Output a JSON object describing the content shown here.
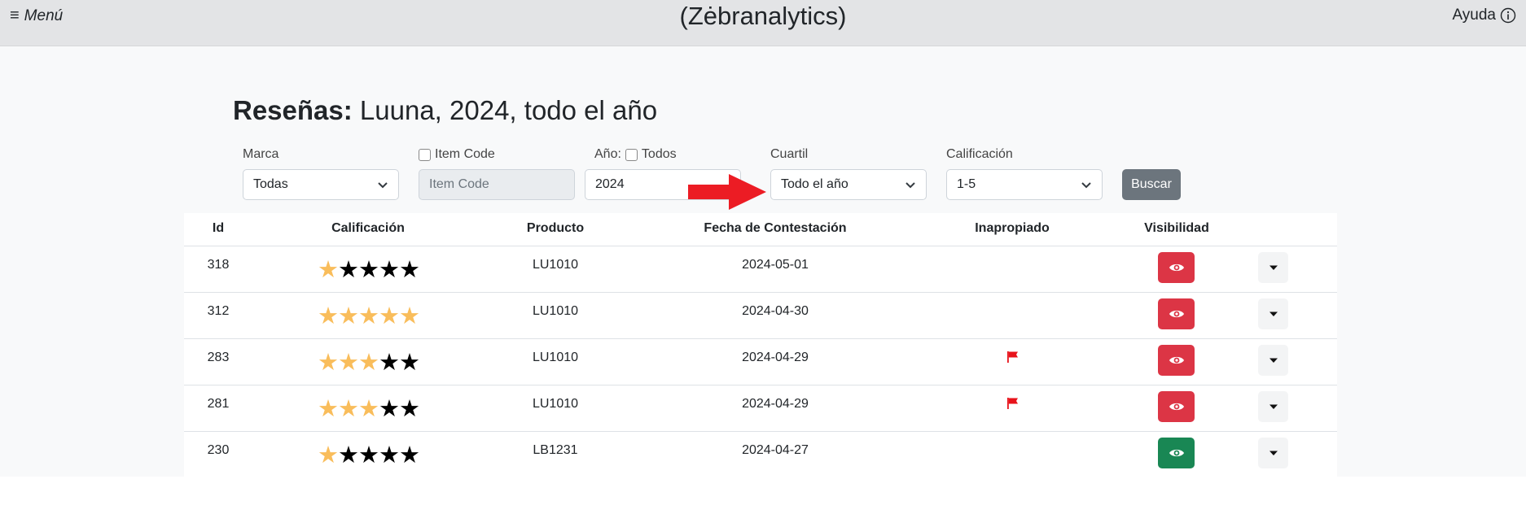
{
  "header": {
    "menu_label": "Menú",
    "menu_icon": "≡",
    "app_title": "(Zėbranalytics)",
    "help_label": "Ayuda"
  },
  "page": {
    "heading_bold": "Reseñas:",
    "heading_rest": "Luuna, 2024, todo el año"
  },
  "filters": {
    "marca": {
      "label": "Marca",
      "value": "Todas"
    },
    "item_code": {
      "label": "Item Code",
      "placeholder": "Item Code",
      "checked": false
    },
    "anio": {
      "label": "Año:",
      "todos_label": "Todos",
      "todos_checked": false,
      "value": "2024"
    },
    "cuartil": {
      "label": "Cuartil",
      "value": "Todo el año"
    },
    "calificacion": {
      "label": "Calificación",
      "value": "1-5"
    },
    "search_button": "Buscar"
  },
  "colors": {
    "star_on": "#f9bd5b",
    "star_off": "#000000",
    "visibility_hidden": "#dc3545",
    "visibility_visible": "#198754",
    "flag": "#e8131b",
    "arrow": "#ec1c24"
  },
  "table": {
    "columns": [
      "Id",
      "Calificación",
      "Producto",
      "Fecha de Contestación",
      "Inapropiado",
      "Visibilidad"
    ],
    "rows": [
      {
        "id": "318",
        "rating": 1,
        "product": "LU1010",
        "date": "2024-05-01",
        "inappropriate": false,
        "visible": false
      },
      {
        "id": "312",
        "rating": 5,
        "product": "LU1010",
        "date": "2024-04-30",
        "inappropriate": false,
        "visible": false
      },
      {
        "id": "283",
        "rating": 3,
        "product": "LU1010",
        "date": "2024-04-29",
        "inappropriate": true,
        "visible": false
      },
      {
        "id": "281",
        "rating": 3,
        "product": "LU1010",
        "date": "2024-04-29",
        "inappropriate": true,
        "visible": false
      },
      {
        "id": "230",
        "rating": 1,
        "product": "LB1231",
        "date": "2024-04-27",
        "inappropriate": false,
        "visible": true
      }
    ]
  }
}
